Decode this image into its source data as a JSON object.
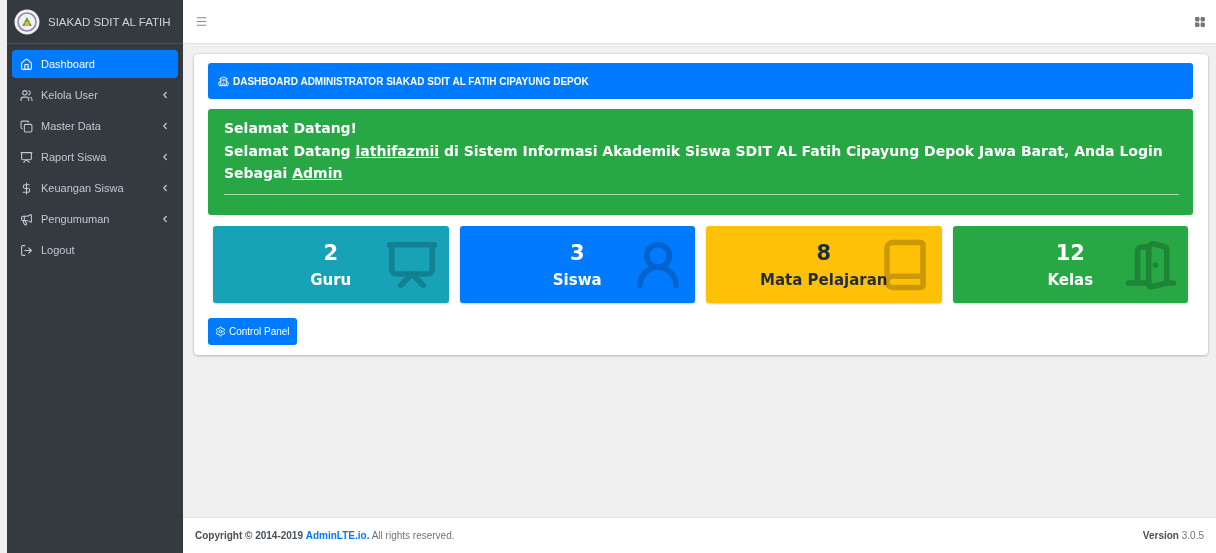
{
  "brand": {
    "title": "SIAKAD SDIT AL FATIH"
  },
  "sidebar": {
    "items": [
      {
        "label": "Dashboard",
        "kind": "home",
        "selected": true,
        "expandable": false
      },
      {
        "label": "Kelola User",
        "kind": "users",
        "selected": false,
        "expandable": true
      },
      {
        "label": "Master Data",
        "kind": "copy",
        "selected": false,
        "expandable": true
      },
      {
        "label": "Raport Siswa",
        "kind": "report",
        "selected": false,
        "expandable": true
      },
      {
        "label": "Keuangan Siswa",
        "kind": "dollar",
        "selected": false,
        "expandable": true
      },
      {
        "label": "Pengumuman",
        "kind": "megaphone",
        "selected": false,
        "expandable": true
      },
      {
        "label": "Logout",
        "kind": "logout",
        "selected": false,
        "expandable": false
      }
    ]
  },
  "header": {
    "title": "DASHBOARD ADMINISTRATOR SIAKAD SDIT AL FATIH CIPAYUNG DEPOK"
  },
  "welcome": {
    "title": "Selamat Datang!",
    "message": [
      {
        "kind": "text",
        "text": "Selamat Datang "
      },
      {
        "kind": "link",
        "text": "lathifazmii"
      },
      {
        "kind": "text",
        "text": " di Sistem Informasi Akademik Siswa SDIT AL Fatih Cipayung Depok Jawa Barat, Anda Login Sebagai "
      },
      {
        "kind": "link",
        "text": "Admin"
      }
    ]
  },
  "stats": [
    {
      "value": "2",
      "label": "Guru",
      "color": "#17a2b8",
      "kind": "teacher"
    },
    {
      "value": "3",
      "label": "Siswa",
      "color": "#007bff",
      "kind": "student"
    },
    {
      "value": "8",
      "label": "Mata Pelajaran",
      "color": "#ffc107",
      "kind": "book"
    },
    {
      "value": "12",
      "label": "Kelas",
      "color": "#28a745",
      "kind": "door"
    }
  ],
  "control_panel": {
    "label": "Control Panel"
  },
  "footer": {
    "copyright": "Copyright © 2014-2019",
    "link": "AdminLTE.io.",
    "rights": "All rights reserved.",
    "version_label": "Version",
    "version": "3.0.5"
  }
}
